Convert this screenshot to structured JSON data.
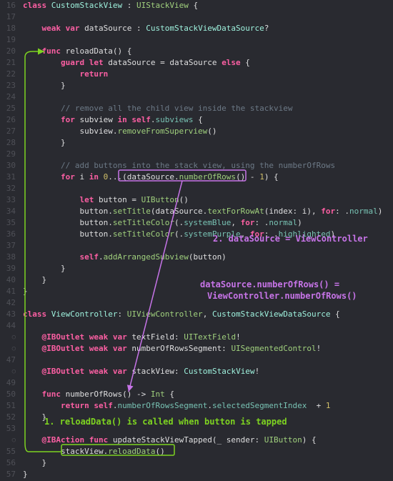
{
  "gutter": [
    "16",
    "17",
    "18",
    "19",
    "20",
    "21",
    "22",
    "23",
    "24",
    "25",
    "26",
    "27",
    "28",
    "29",
    "30",
    "31",
    "32",
    "33",
    "34",
    "35",
    "36",
    "37",
    "38",
    "39",
    "40",
    "41",
    "42",
    "43",
    "44",
    "○",
    "○",
    "47",
    "○",
    "49",
    "50",
    "51",
    "52",
    "53",
    "○",
    "55",
    "56",
    "57"
  ],
  "code": {
    "l0": "class CustomStackView : UIStackView {",
    "l1": "",
    "l2": "    weak var dataSource : CustomStackViewDataSource?",
    "l3": "",
    "l4": "    func reloadData() {",
    "l5": "        guard let dataSource = dataSource else {",
    "l6": "            return",
    "l7": "        }",
    "l8": "",
    "l9": "        // remove all the child view inside the stackview",
    "l10": "        for subview in self.subviews {",
    "l11": "            subview.removeFromSuperview()",
    "l12": "        }",
    "l13": "",
    "l14": "        // add buttons into the stack view, using the numberOfRows",
    "l15": "        for i in 0...(dataSource.numberOfRows() - 1) {",
    "l16": "",
    "l17": "            let button = UIButton()",
    "l18": "            button.setTitle(dataSource.textForRowAt(index: i), for: .normal)",
    "l19": "            button.setTitleColor(.systemBlue, for: .normal)",
    "l20": "            button.setTitleColor(.systemPurple, for: .highlighted)",
    "l21": "",
    "l22": "            self.addArrangedSubview(button)",
    "l23": "        }",
    "l24": "    }",
    "l25": "}",
    "l26": "",
    "l27": "class ViewController: UIViewController, CustomStackViewDataSource {",
    "l28": "",
    "l29": "    @IBOutlet weak var textField: UITextField!",
    "l30": "    @IBOutlet weak var numberOfRowsSegment: UISegmentedControl!",
    "l31": "",
    "l32": "    @IBOutlet weak var stackView: CustomStackView!",
    "l33": "",
    "l34": "    func numberOfRows() -> Int {",
    "l35": "        return self.numberOfRowsSegment.selectedSegmentIndex  + 1",
    "l36": "    }",
    "l37": "",
    "l38": "    @IBAction func updateStackViewTapped(_ sender: UIButton) {",
    "l39": "        stackView.reloadData()",
    "l40": "    }",
    "l41": "}"
  },
  "annotations": {
    "a1": "2. dataSource = ViewController",
    "a2": "dataSource.numberOfRows() =",
    "a3": "ViewController.numberOfRows()",
    "a4": "1. reloadData() is called when button is tapped"
  }
}
